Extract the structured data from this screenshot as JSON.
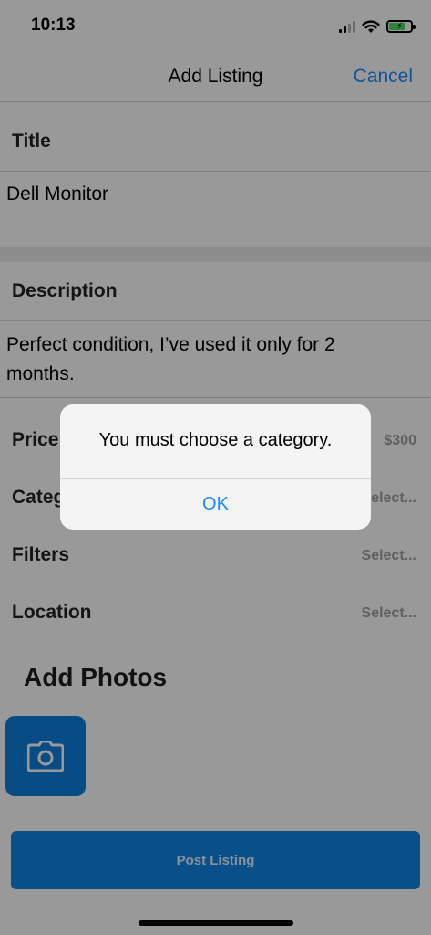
{
  "status_bar": {
    "time": "10:13"
  },
  "nav": {
    "title": "Add Listing",
    "cancel_label": "Cancel"
  },
  "form": {
    "title": {
      "label": "Title",
      "value": "Dell Monitor"
    },
    "description": {
      "label": "Description",
      "value": "Perfect condition, I’ve used it only for 2 months."
    },
    "rows": [
      {
        "label": "Price",
        "value": "$300"
      },
      {
        "label": "Category",
        "value": "Select..."
      },
      {
        "label": "Filters",
        "value": "Select..."
      },
      {
        "label": "Location",
        "value": "Select..."
      }
    ],
    "photos_title": "Add Photos",
    "post_button_label": "Post Listing"
  },
  "alert": {
    "message": "You must choose a category.",
    "ok_label": "OK"
  },
  "colors": {
    "accent": "#1a8dff",
    "button_blue": "#0f84e6",
    "battery_green": "#4cd964"
  }
}
